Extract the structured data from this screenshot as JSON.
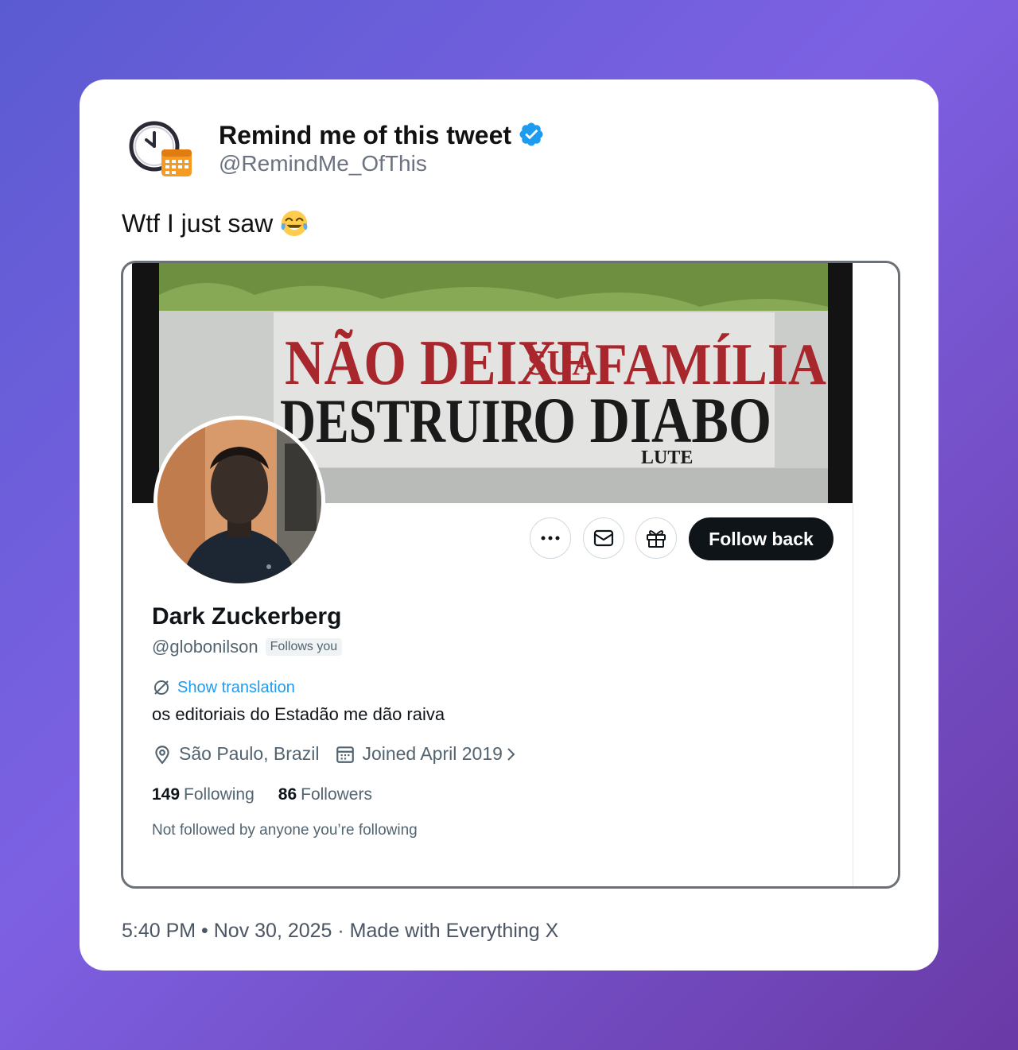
{
  "tweet": {
    "author_name": "Remind me of this tweet",
    "author_handle": "@RemindMe_OfThis",
    "verified": true,
    "text": "Wtf I just saw",
    "emoji": "face-with-tears-of-joy",
    "footer": "5:40 PM • Nov 30, 2025 · Made with Everything X"
  },
  "embedded_profile": {
    "banner_text": [
      "NÃO DEIXE",
      "SUA",
      "FAMÍLIA",
      "DESTRUIR",
      "O DIABO",
      "LUTE"
    ],
    "display_name": "Dark Zuckerberg",
    "handle": "@globonilson",
    "follows_you_badge": "Follows you",
    "show_translation": "Show translation",
    "bio": "os editoriais do Estadão me dão raiva",
    "location": "São Paulo, Brazil",
    "joined": "Joined April 2019",
    "following_count": "149",
    "following_label": "Following",
    "followers_count": "86",
    "followers_label": "Followers",
    "mutuals_note": "Not followed by anyone you’re following",
    "follow_button": "Follow back",
    "icons": [
      "more-icon",
      "message-icon",
      "gift-icon",
      "location-icon",
      "calendar-icon",
      "chevron-right-icon",
      "translate-icon"
    ]
  },
  "colors": {
    "background_gradient": [
      "#5b5bd1",
      "#7d61e3",
      "#6a3aa6"
    ],
    "verified_blue": "#1d9bf0",
    "link_blue": "#1d9bf0",
    "follow_button": "#0f1419"
  }
}
